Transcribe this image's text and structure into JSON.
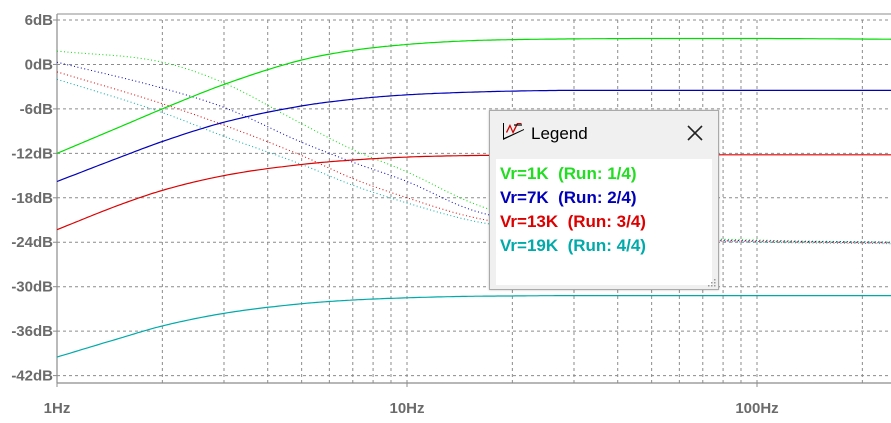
{
  "chart_data": {
    "type": "line",
    "x_scale": "log",
    "xlim": [
      1,
      250
    ],
    "ylim": [
      -43,
      6
    ],
    "x_ticks": [
      {
        "value": 1,
        "label": "1Hz"
      },
      {
        "value": 10,
        "label": "10Hz"
      },
      {
        "value": 100,
        "label": "100Hz"
      }
    ],
    "y_ticks": [
      {
        "value": 6,
        "label": "6dB"
      },
      {
        "value": 0,
        "label": "0dB"
      },
      {
        "value": -6,
        "label": "-6dB"
      },
      {
        "value": -12,
        "label": "-12dB"
      },
      {
        "value": -18,
        "label": "-18dB"
      },
      {
        "value": -24,
        "label": "-24dB"
      },
      {
        "value": -30,
        "label": "-30dB"
      },
      {
        "value": -36,
        "label": "-36dB"
      },
      {
        "value": -42,
        "label": "-42dB"
      }
    ],
    "grid": true,
    "grid_style": "dashed",
    "x_unit": "Hz",
    "y_unit": "dB",
    "series": [
      {
        "name": "Vr=1K  (Run: 1/4)",
        "color": "#00dd00",
        "magnitude": {
          "x": [
            1,
            1.5,
            2,
            3,
            5,
            7,
            10,
            15,
            20,
            30,
            50,
            100,
            250
          ],
          "y": [
            -12,
            -8.5,
            -6,
            -2.7,
            0.6,
            1.9,
            2.7,
            3.2,
            3.35,
            3.45,
            3.5,
            3.5,
            3.4
          ]
        },
        "phase_dotted": {
          "x": [
            1,
            2,
            3,
            5,
            7,
            10,
            15,
            20,
            30,
            50,
            100,
            250
          ],
          "y": [
            1.8,
            0.3,
            -2.5,
            -8,
            -11.5,
            -14.5,
            -18.5,
            -20.5,
            -22.2,
            -23.2,
            -23.7,
            -24
          ]
        }
      },
      {
        "name": "Vr=7K  (Run: 2/4)",
        "color": "#0000bb",
        "magnitude": {
          "x": [
            1,
            1.5,
            2,
            3,
            5,
            7,
            10,
            15,
            20,
            30,
            50,
            100,
            250
          ],
          "y": [
            -15.8,
            -12.6,
            -10.4,
            -7.8,
            -5.6,
            -4.7,
            -4.1,
            -3.75,
            -3.6,
            -3.5,
            -3.5,
            -3.5,
            -3.5
          ]
        },
        "phase_dotted": {
          "x": [
            1,
            2,
            3,
            5,
            7,
            10,
            15,
            20,
            30,
            50,
            100,
            250
          ],
          "y": [
            0.3,
            -3.2,
            -5.8,
            -10.5,
            -13.2,
            -15.8,
            -19.5,
            -21,
            -22.5,
            -23.4,
            -23.8,
            -24
          ]
        }
      },
      {
        "name": "Vr=13K  (Run: 3/4)",
        "color": "#dd0000",
        "magnitude": {
          "x": [
            1,
            1.5,
            2,
            3,
            5,
            7,
            10,
            15,
            20,
            30,
            50,
            100,
            250
          ],
          "y": [
            -22.3,
            -19,
            -17,
            -15,
            -13.5,
            -12.9,
            -12.5,
            -12.3,
            -12.25,
            -12.2,
            -12.2,
            -12.2,
            -12.2
          ]
        },
        "phase_dotted": {
          "x": [
            1,
            2,
            3,
            5,
            7,
            10,
            15,
            20,
            30,
            50,
            100,
            250
          ],
          "y": [
            -1,
            -5.3,
            -8.2,
            -12.3,
            -15.4,
            -18,
            -20.5,
            -21.6,
            -22.8,
            -23.5,
            -23.9,
            -24.1
          ]
        }
      },
      {
        "name": "Vr=19K  (Run: 4/4)",
        "color": "#00aaaa",
        "magnitude": {
          "x": [
            1,
            1.5,
            2,
            3,
            5,
            7,
            10,
            15,
            20,
            30,
            50,
            100,
            250
          ],
          "y": [
            -39.5,
            -37,
            -35.3,
            -33.6,
            -32.3,
            -31.8,
            -31.5,
            -31.3,
            -31.25,
            -31.2,
            -31.2,
            -31.2,
            -31.2
          ]
        },
        "phase_dotted": {
          "x": [
            1,
            2,
            3,
            5,
            7,
            10,
            15,
            20,
            30,
            50,
            100,
            250
          ],
          "y": [
            -2,
            -6.5,
            -9.7,
            -13.5,
            -16.3,
            -18.7,
            -21,
            -22,
            -23,
            -23.6,
            -24,
            -24.2
          ]
        }
      }
    ]
  },
  "legend": {
    "title": "Legend",
    "logo_icon": "ltspice-logo-icon",
    "close_icon": "close-icon",
    "entries": [
      {
        "label": "Vr=1K  (Run: 1/4)",
        "color": "#22dd22"
      },
      {
        "label": "Vr=7K  (Run: 2/4)",
        "color": "#0000bb"
      },
      {
        "label": "Vr=13K  (Run: 3/4)",
        "color": "#dd0000"
      },
      {
        "label": "Vr=19K  (Run: 4/4)",
        "color": "#00aaaa"
      }
    ]
  }
}
